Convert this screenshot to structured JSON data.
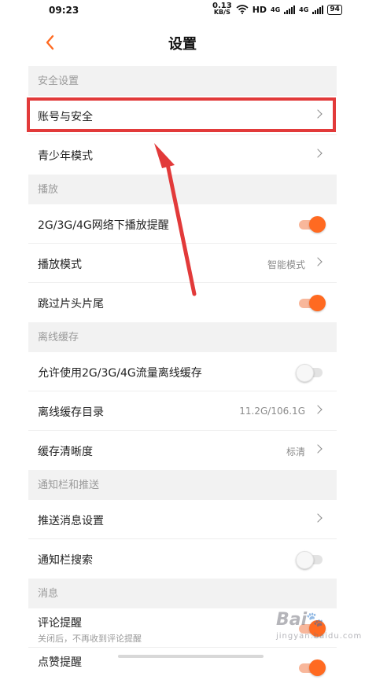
{
  "status_bar": {
    "time": "09:23",
    "net_speed_value": "0.13",
    "net_speed_unit": "KB/S",
    "hd_label": "HD",
    "network_1": "4G",
    "network_2": "4G",
    "battery": "94"
  },
  "header": {
    "title": "设置"
  },
  "sections": {
    "security": {
      "title": "安全设置",
      "account": "账号与安全",
      "teen_mode": "青少年模式"
    },
    "playback": {
      "title": "播放",
      "mobile_play_alert": "2G/3G/4G网络下播放提醒",
      "mobile_play_alert_on": true,
      "play_mode": "播放模式",
      "play_mode_value": "智能模式",
      "skip_intro": "跳过片头片尾",
      "skip_intro_on": true
    },
    "offline": {
      "title": "离线缓存",
      "allow_mobile_cache": "允许使用2G/3G/4G流量离线缓存",
      "allow_mobile_cache_on": false,
      "cache_dir": "离线缓存目录",
      "cache_dir_value": "11.2G/106.1G",
      "cache_quality": "缓存清晰度",
      "cache_quality_value": "标清"
    },
    "notification": {
      "title": "通知栏和推送",
      "push_settings": "推送消息设置",
      "bar_search": "通知栏搜索",
      "bar_search_on": false
    },
    "messages": {
      "title": "消息",
      "comment_alert": "评论提醒",
      "comment_alert_sub": "关闭后，不再收到评论提醒",
      "comment_alert_on": true,
      "like_alert": "点赞提醒",
      "like_alert_on": true
    }
  },
  "watermark": {
    "brand": "Bai",
    "suffix": "jingyan.baidu.com"
  },
  "colors": {
    "accent": "#ff6a21",
    "highlight": "#e23a3a",
    "section_bg": "#f2f2f2"
  }
}
